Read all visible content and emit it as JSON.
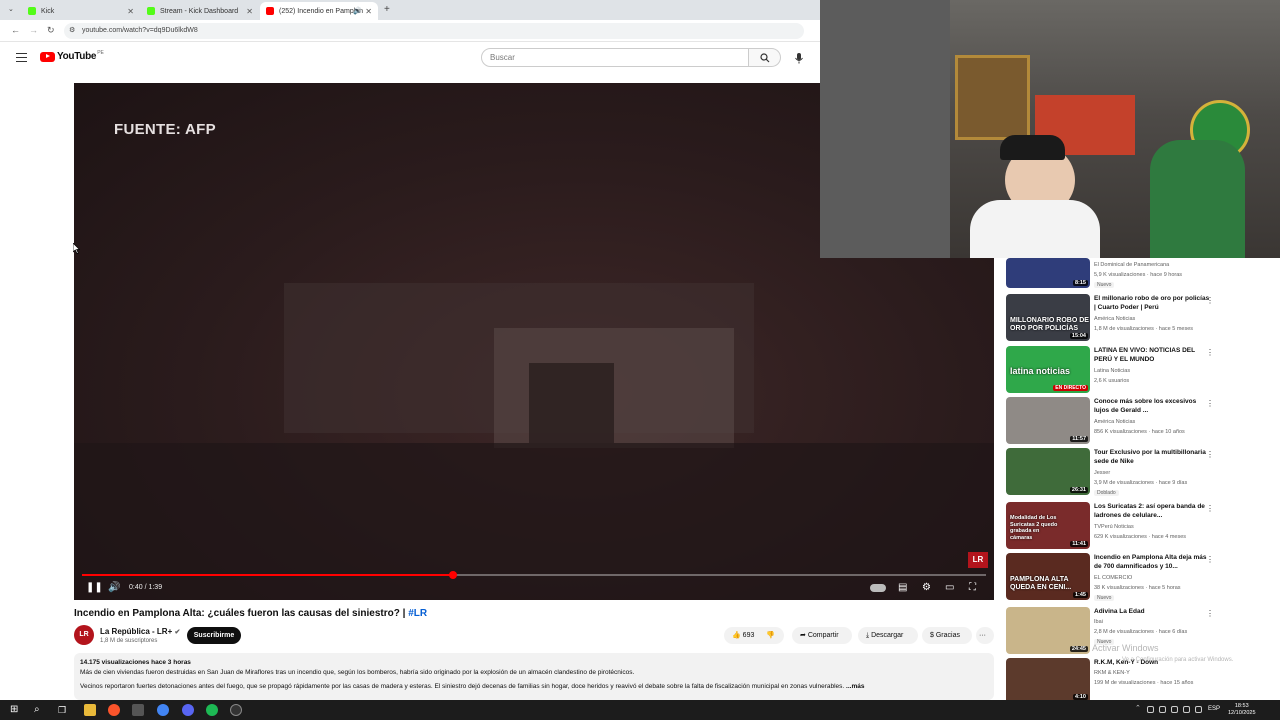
{
  "browser": {
    "tabs": [
      {
        "label": "Kick",
        "color": "#53fc18"
      },
      {
        "label": "Stream - Kick Dashboard",
        "color": "#53fc18"
      },
      {
        "label": "(252) Incendio en Pamplon",
        "color": "#ff0000"
      }
    ],
    "url": "youtube.com/watch?v=dq9Du6lkdW8"
  },
  "youtube": {
    "logo_text": "YouTube",
    "country": "PE",
    "search_placeholder": "Buscar"
  },
  "player": {
    "overlay_text": "FUENTE: AFP",
    "watermark": "LR",
    "time": "0:40 / 1:39",
    "progress": 0.41
  },
  "video": {
    "title": "Incendio en Pamplona Alta: ¿cuáles fueron las causas del siniestro?",
    "hashtag": "#LR",
    "channel_name": "La República - LR+",
    "channel_avatar": "LR",
    "subscribers": "1,8 M de suscriptores",
    "subscribe_label": "Suscribirme",
    "likes": "693",
    "share_label": "Compartir",
    "download_label": "Descargar",
    "thanks_label": "Gracias",
    "more_actions": "···"
  },
  "description": {
    "stats": "14.175 visualizaciones  hace 3 horas",
    "line1": "Más de cien viviendas fueron destruidas en San Juan de Miraflores tras un incendio que, según los bomberos, habría sido originado por la explosión de un almacén clandestino de pirotécnicos.",
    "line2": "Vecinos reportaron fuertes detonaciones antes del fuego, que se propagó rápidamente por las casas de madera y esteras. El siniestro dejó decenas de familias sin hogar, doce heridos y reavivó el debate sobre la falta de fiscalización municipal en zonas vulnerables.",
    "more": "...más"
  },
  "sidebar": {
    "items": [
      {
        "title": "",
        "channel": "El Dominical de Panamericana",
        "meta": "5,9 K visualizaciones · hace 9 horas",
        "badge": "Nuevo",
        "duration": "8:15",
        "thumb_color": "#2f3d7a",
        "thumb_text": ""
      },
      {
        "title": "El millonario robo de oro por policías | Cuarto Poder | Perú",
        "channel": "América Noticias",
        "meta": "1,8 M de visualizaciones · hace 5 meses",
        "badge": "",
        "duration": "15:04",
        "thumb_color": "#3a3d45",
        "thumb_text": "MILLONARIO ROBO DE ORO POR POLICÍAS"
      },
      {
        "title": "LATINA EN VIVO: NOTICIAS DEL PERÚ Y EL MUNDO",
        "channel": "Latina Noticias",
        "meta": "2,6 K usuarios",
        "badge": "",
        "duration": "EN DIRECTO",
        "thumb_color": "#2fa84a",
        "thumb_text": "latina noticias"
      },
      {
        "title": "Conoce más sobre los excesivos lujos de Gerald ...",
        "channel": "América Noticias",
        "meta": "856 K visualizaciones · hace 10 años",
        "badge": "",
        "duration": "11:57",
        "thumb_color": "#8f8a86",
        "thumb_text": ""
      },
      {
        "title": "Tour Exclusivo por la multibillonaria sede de Nike",
        "channel": "Jesser",
        "meta": "3,9 M de visualizaciones · hace 9 días",
        "badge": "Doblado",
        "duration": "26:31",
        "thumb_color": "#3f6b3a",
        "thumb_text": ""
      },
      {
        "title": "Los Suricatas 2: así opera banda de ladrones de celulare...",
        "channel": "TVPerú Noticias",
        "meta": "629 K visualizaciones · hace 4 meses",
        "badge": "",
        "duration": "11:41",
        "thumb_color": "#7a2b2b",
        "thumb_text": "Modalidad de Los Suricatas 2 quedo grabada en cámaras"
      },
      {
        "title": "Incendio en Pamplona Alta deja más de 700 damnificados y 10...",
        "channel": "EL COMERCIO",
        "meta": "38 K visualizaciones · hace 5 horas",
        "badge": "Nuevo",
        "duration": "1:45",
        "thumb_color": "#5a2a20",
        "thumb_text": "PAMPLONA ALTA QUEDA EN CENI..."
      },
      {
        "title": "Adivina La Edad",
        "channel": "Ibai",
        "meta": "2,8 M de visualizaciones · hace 6 días",
        "badge": "Nuevo",
        "duration": "24:45",
        "thumb_color": "#c9b58a",
        "thumb_text": ""
      },
      {
        "title": "R.K.M, Ken-Y - Down",
        "channel": "RKM & KEN-Y",
        "meta": "199 M de visualizaciones · hace 15 años",
        "badge": "",
        "duration": "4:10",
        "thumb_color": "#5c3a2c",
        "thumb_text": ""
      }
    ]
  },
  "watermark": {
    "line1": "Activar Windows",
    "line2": "Ve a Configuración para activar Windows."
  },
  "taskbar": {
    "lang": "ESP",
    "time": "18:53",
    "date": "12/10/2025"
  }
}
